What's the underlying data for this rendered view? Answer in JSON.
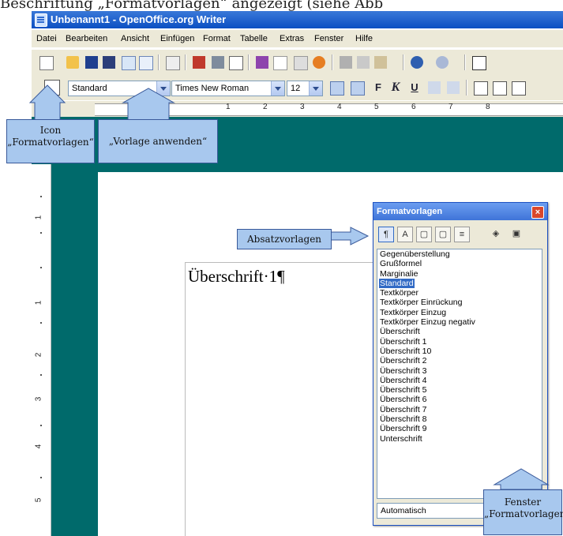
{
  "caption": "Beschriftung „Formatvorlagen“ angezeigt (siehe Abb",
  "window": {
    "title": "Unbenannt1 - OpenOffice.org Writer"
  },
  "menu": [
    "Datei",
    "Bearbeiten",
    "Ansicht",
    "Einfügen",
    "Format",
    "Tabelle",
    "Extras",
    "Fenster",
    "Hilfe"
  ],
  "formatting": {
    "style": "Standard",
    "font": "Times New Roman",
    "size": "12"
  },
  "format_buttons": [
    "F",
    "K",
    "U"
  ],
  "ruler_numbers": [
    "1",
    "2",
    "3",
    "4",
    "5",
    "6",
    "7",
    "8"
  ],
  "vruler_numbers": [
    "1",
    "1",
    "2",
    "3",
    "4",
    "5"
  ],
  "document": {
    "heading": "Überschrift·1¶"
  },
  "styles_panel": {
    "title": "Formatvorlagen",
    "items": [
      "Gegenüberstellung",
      "Grußformel",
      "Marginalie",
      "Standard",
      "Textkörper",
      "Textkörper Einrückung",
      "Textkörper Einzug",
      "Textkörper Einzug negativ",
      "Überschrift",
      "Überschrift 1",
      "Überschrift 10",
      "Überschrift 2",
      "Überschrift 3",
      "Überschrift 4",
      "Überschrift 5",
      "Überschrift 6",
      "Überschrift 7",
      "Überschrift 8",
      "Überschrift 9",
      "Unterschrift"
    ],
    "selected": "Standard",
    "filter": "Automatisch"
  },
  "callouts": {
    "icon_line1": "Icon",
    "icon_line2": "„Formatvorlagen“",
    "apply": "„Vorlage anwenden“",
    "absatz": "Absatzvorlagen",
    "fenster_line1": "Fenster",
    "fenster_line2": "„Formatvorlagen“"
  },
  "colors": {
    "workspace": "#006a6b",
    "titlebar": "#0b4fc3",
    "callout": "#a8c8ee",
    "selection": "#316ac5"
  }
}
